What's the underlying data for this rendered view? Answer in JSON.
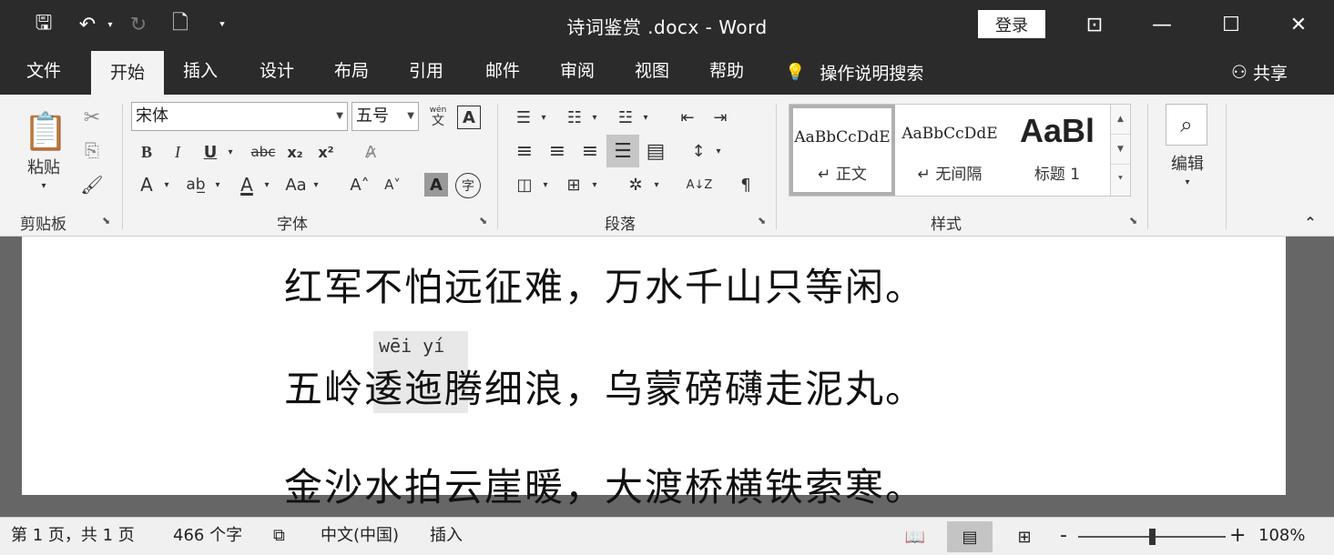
{
  "titlebar": {
    "doc_title": "诗词鉴赏  .docx  -  Word",
    "login": "登录",
    "quick_access": [
      {
        "name": "save-icon",
        "glyph": "🖫"
      },
      {
        "name": "undo-icon",
        "glyph": "↶"
      },
      {
        "name": "redo-icon",
        "glyph": "↻"
      },
      {
        "name": "new-document-icon",
        "glyph": "🗋"
      },
      {
        "name": "customize-quick-access-icon",
        "glyph": "⯆"
      }
    ],
    "window_buttons": [
      {
        "name": "ribbon-display-options-icon",
        "glyph": "⊡"
      },
      {
        "name": "minimize-icon",
        "glyph": "—"
      },
      {
        "name": "maximize-icon",
        "glyph": "☐"
      },
      {
        "name": "close-icon",
        "glyph": "✕"
      }
    ]
  },
  "tabs": [
    {
      "label": "文件"
    },
    {
      "label": "开始",
      "active": true
    },
    {
      "label": "插入"
    },
    {
      "label": "设计"
    },
    {
      "label": "布局"
    },
    {
      "label": "引用"
    },
    {
      "label": "邮件"
    },
    {
      "label": "审阅"
    },
    {
      "label": "视图"
    },
    {
      "label": "帮助"
    }
  ],
  "tell_me": {
    "icon": "lightbulb-icon",
    "glyph": "💡",
    "label": "操作说明搜索"
  },
  "share": {
    "icon": "person-add-icon",
    "glyph": "⚇",
    "label": "共享"
  },
  "ribbon": {
    "clipboard": {
      "label": "剪贴板",
      "paste_label": "粘贴",
      "paste_glyph": "📋",
      "cut_glyph": "✂",
      "copy_glyph": "⎘",
      "format_painter_glyph": "🖌"
    },
    "font": {
      "label": "字体",
      "font_name": "宋体",
      "font_size": "五号",
      "phonetic_glyph": "wén",
      "phonetic_char": "文",
      "border_char": "A",
      "bold": "B",
      "italic": "I",
      "underline": "U",
      "strike": "abc",
      "subscript": "x₂",
      "superscript": "x²",
      "clear_format_glyph": "A̷",
      "text_effect": "A",
      "highlight": "ab̲",
      "font_color": "A",
      "change_case": "Aa",
      "grow": "A˄",
      "shrink": "A˅",
      "shading": "A",
      "enclose": "字"
    },
    "paragraph": {
      "label": "段落",
      "bullets": "☰",
      "numbering": "☷",
      "multilevel": "☳",
      "decrease_indent": "⇤",
      "increase_indent": "⇥",
      "align_left": "≡",
      "center": "≡",
      "align_right": "≡",
      "justify": "☰",
      "distributed": "▤",
      "line_spacing": "↕",
      "shading": "◫",
      "borders": "⊞",
      "chinese_layout": "✲",
      "sort": "A↓Z",
      "show_marks": "¶"
    },
    "styles": {
      "label": "样式",
      "items": [
        {
          "sample": "AaBbCcDdE",
          "name": "↵ 正文",
          "selected": true
        },
        {
          "sample": "AaBbCcDdE",
          "name": "↵ 无间隔"
        },
        {
          "sample": "AaBl",
          "name": "标题 1"
        }
      ]
    },
    "editing": {
      "label": "编辑",
      "glyph": "⌕"
    },
    "collapse_glyph": "⌃"
  },
  "document": {
    "lines": [
      "红军不怕远征难，万水千山只等闲。",
      "五岭逶迤腾细浪，乌蒙磅礴走泥丸。",
      "金沙水拍云崖暖，大渡桥横铁索寒。"
    ],
    "ruby_text": "wēi yí"
  },
  "statusbar": {
    "page": "第 1 页，共 1 页",
    "words": "466 个字",
    "proofing_glyph": "⧉",
    "language": "中文(中国)",
    "mode": "插入",
    "views": [
      {
        "name": "read-mode-icon",
        "glyph": "📖"
      },
      {
        "name": "print-layout-icon",
        "glyph": "▤",
        "on": true
      },
      {
        "name": "web-layout-icon",
        "glyph": "⊞"
      }
    ],
    "zoom_minus": "-",
    "zoom_plus": "+",
    "zoom": "108%",
    "zoom_fraction": 0.5
  }
}
